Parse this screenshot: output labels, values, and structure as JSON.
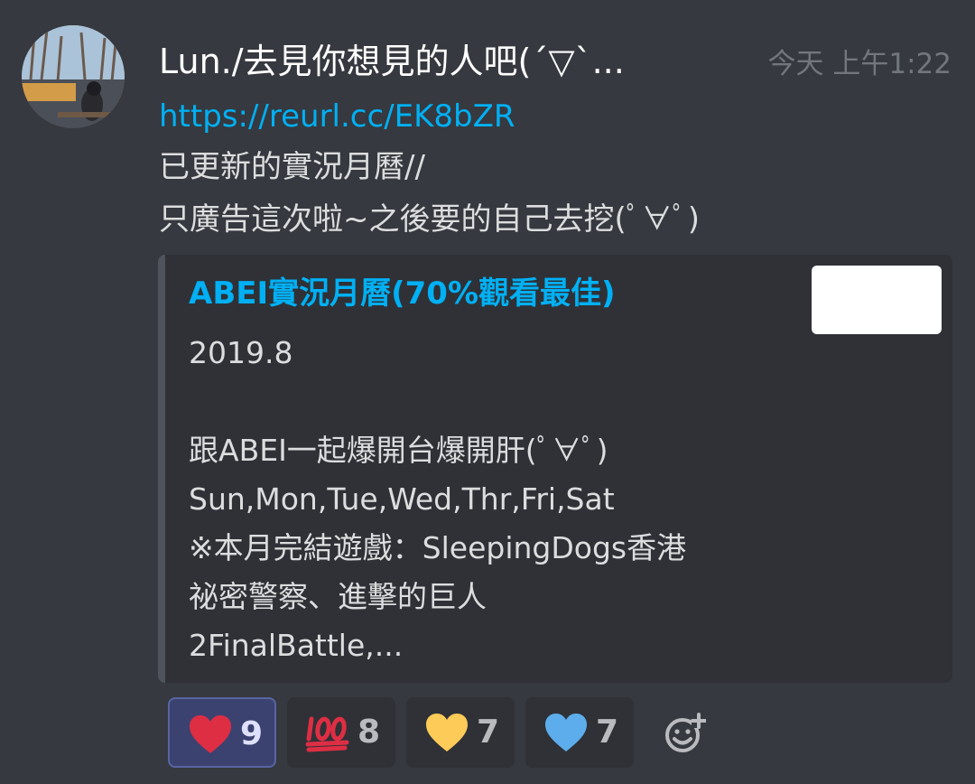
{
  "message": {
    "username": "Lun./去見你想見的人吧(´▽`...",
    "timestamp": "今天 上午1:22",
    "link": "https://reurl.cc/EK8bZR",
    "lines": [
      "已更新的實況月曆//",
      "只廣告這次啦~之後要的自己去挖(ﾟ∀ﾟ)"
    ]
  },
  "embed": {
    "title": "ABEI實況月曆(70%觀看最佳)",
    "lines": [
      "2019.8",
      "",
      "跟ABEI一起爆開台爆開肝(ﾟ∀ﾟ)",
      "Sun,Mon,Tue,Wed,Thr,Fri,Sat",
      "※本月完結遊戲：SleepingDogs香港",
      "祕密警察、進擊的巨人",
      "2FinalBattle,..."
    ]
  },
  "reactions": [
    {
      "emoji": "red-heart",
      "count": "9",
      "color": "#dd2e44",
      "active": true
    },
    {
      "emoji": "hundred-points",
      "count": "8",
      "color": "#dd2e44",
      "active": false
    },
    {
      "emoji": "yellow-heart",
      "count": "7",
      "color": "#fdcb58",
      "active": false
    },
    {
      "emoji": "blue-heart",
      "count": "7",
      "color": "#5dadec",
      "active": false
    }
  ],
  "colors": {
    "background": "#36393f",
    "embed_background": "#2f3136",
    "link": "#00b0f4",
    "text": "#dcddde",
    "muted": "#72767d"
  }
}
